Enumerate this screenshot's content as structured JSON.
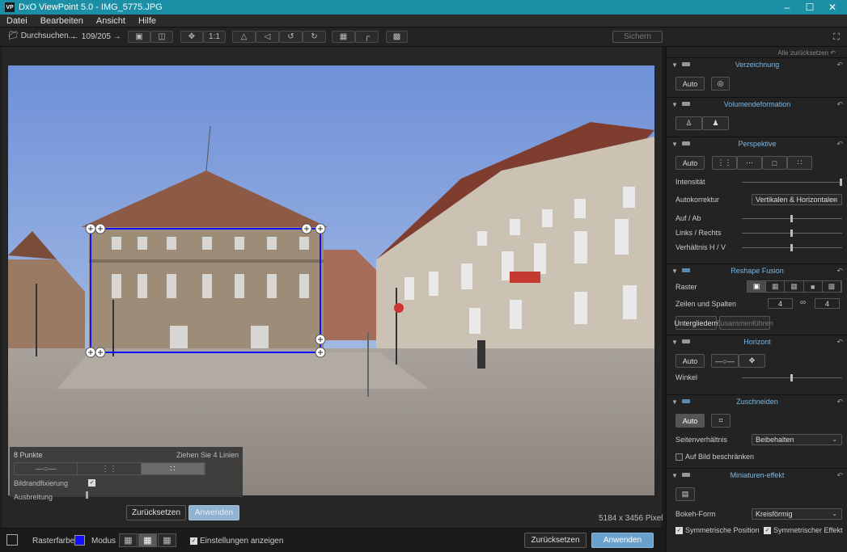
{
  "titlebar": {
    "app_icon": "VP",
    "title": "DxO ViewPoint 5.0 - IMG_5775.JPG",
    "min": "–",
    "max": "☐",
    "close": "✕"
  },
  "menu": [
    "Datei",
    "Bearbeiten",
    "Ansicht",
    "Hilfe"
  ],
  "toolbar": {
    "browse_label": "Durchsuchen...",
    "counter": "109/205",
    "zoom_label": "1:1",
    "save_label": "Sichern"
  },
  "points_panel": {
    "title": "8 Punkte",
    "hint": "Ziehen Sie 4 Linien",
    "bildrand_label": "Bildrandfixierung",
    "bildrand_checked": true,
    "ausbreitung_label": "Ausbreitung",
    "ausbreitung_level": 0
  },
  "viewer": {
    "reset_label": "Zurücksetzen",
    "apply_label": "Anwenden",
    "pixel_info": "5184 x 3456 Pixel"
  },
  "bottombar": {
    "rasterfarbe_label": "Rasterfarbe",
    "raster_color": "#1010ff",
    "modus_label": "Modus",
    "show_settings_label": "Einstellungen anzeigen",
    "show_settings_checked": true,
    "reset_label": "Zurücksetzen",
    "apply_label": "Anwenden"
  },
  "sidebar": {
    "reset_all": "Alle zurücksetzen",
    "verzeichnung": {
      "title": "Verzeichnung",
      "auto_label": "Auto"
    },
    "volumen": {
      "title": "Volumendeformation"
    },
    "perspektive": {
      "title": "Perspektive",
      "auto_label": "Auto",
      "intensitaet_label": "Intensität",
      "intensitaet_value": 1.0,
      "autokorrektur_label": "Autokorrektur",
      "autokorrektur_value": "Vertikalen & Horizontalen",
      "aufab_label": "Auf / Ab",
      "aufab_value": 0.5,
      "linksrechts_label": "Links / Rechts",
      "linksrechts_value": 0.5,
      "verhaeltnis_label": "Verhältnis H / V",
      "verhaeltnis_value": 0.5
    },
    "reshape": {
      "title": "Reshape Fusion",
      "raster_label": "Raster",
      "zeilen_label": "Zeilen und Spalten",
      "rows": "4",
      "cols": "4",
      "unterglieder_label": "Untergliedern",
      "zusammen_label": "Zusammenführen"
    },
    "horizont": {
      "title": "Horizont",
      "auto_label": "Auto",
      "winkel_label": "Winkel",
      "winkel_value": 0.5
    },
    "zuschneiden": {
      "title": "Zuschneiden",
      "auto_label": "Auto",
      "seitenverhaeltnis_label": "Seitenverhältnis",
      "seitenverhaeltnis_value": "Beibehalten",
      "beschraenken_label": "Auf Bild beschränken",
      "beschraenken_checked": false
    },
    "miniatur": {
      "title": "Miniaturen-effekt",
      "bokeh_label": "Bokeh-Form",
      "bokeh_value": "Kreisförmig",
      "sym_pos_label": "Symmetrische Position",
      "sym_pos_checked": true,
      "sym_eff_label": "Symmetrischer Effekt",
      "sym_eff_checked": true
    }
  }
}
